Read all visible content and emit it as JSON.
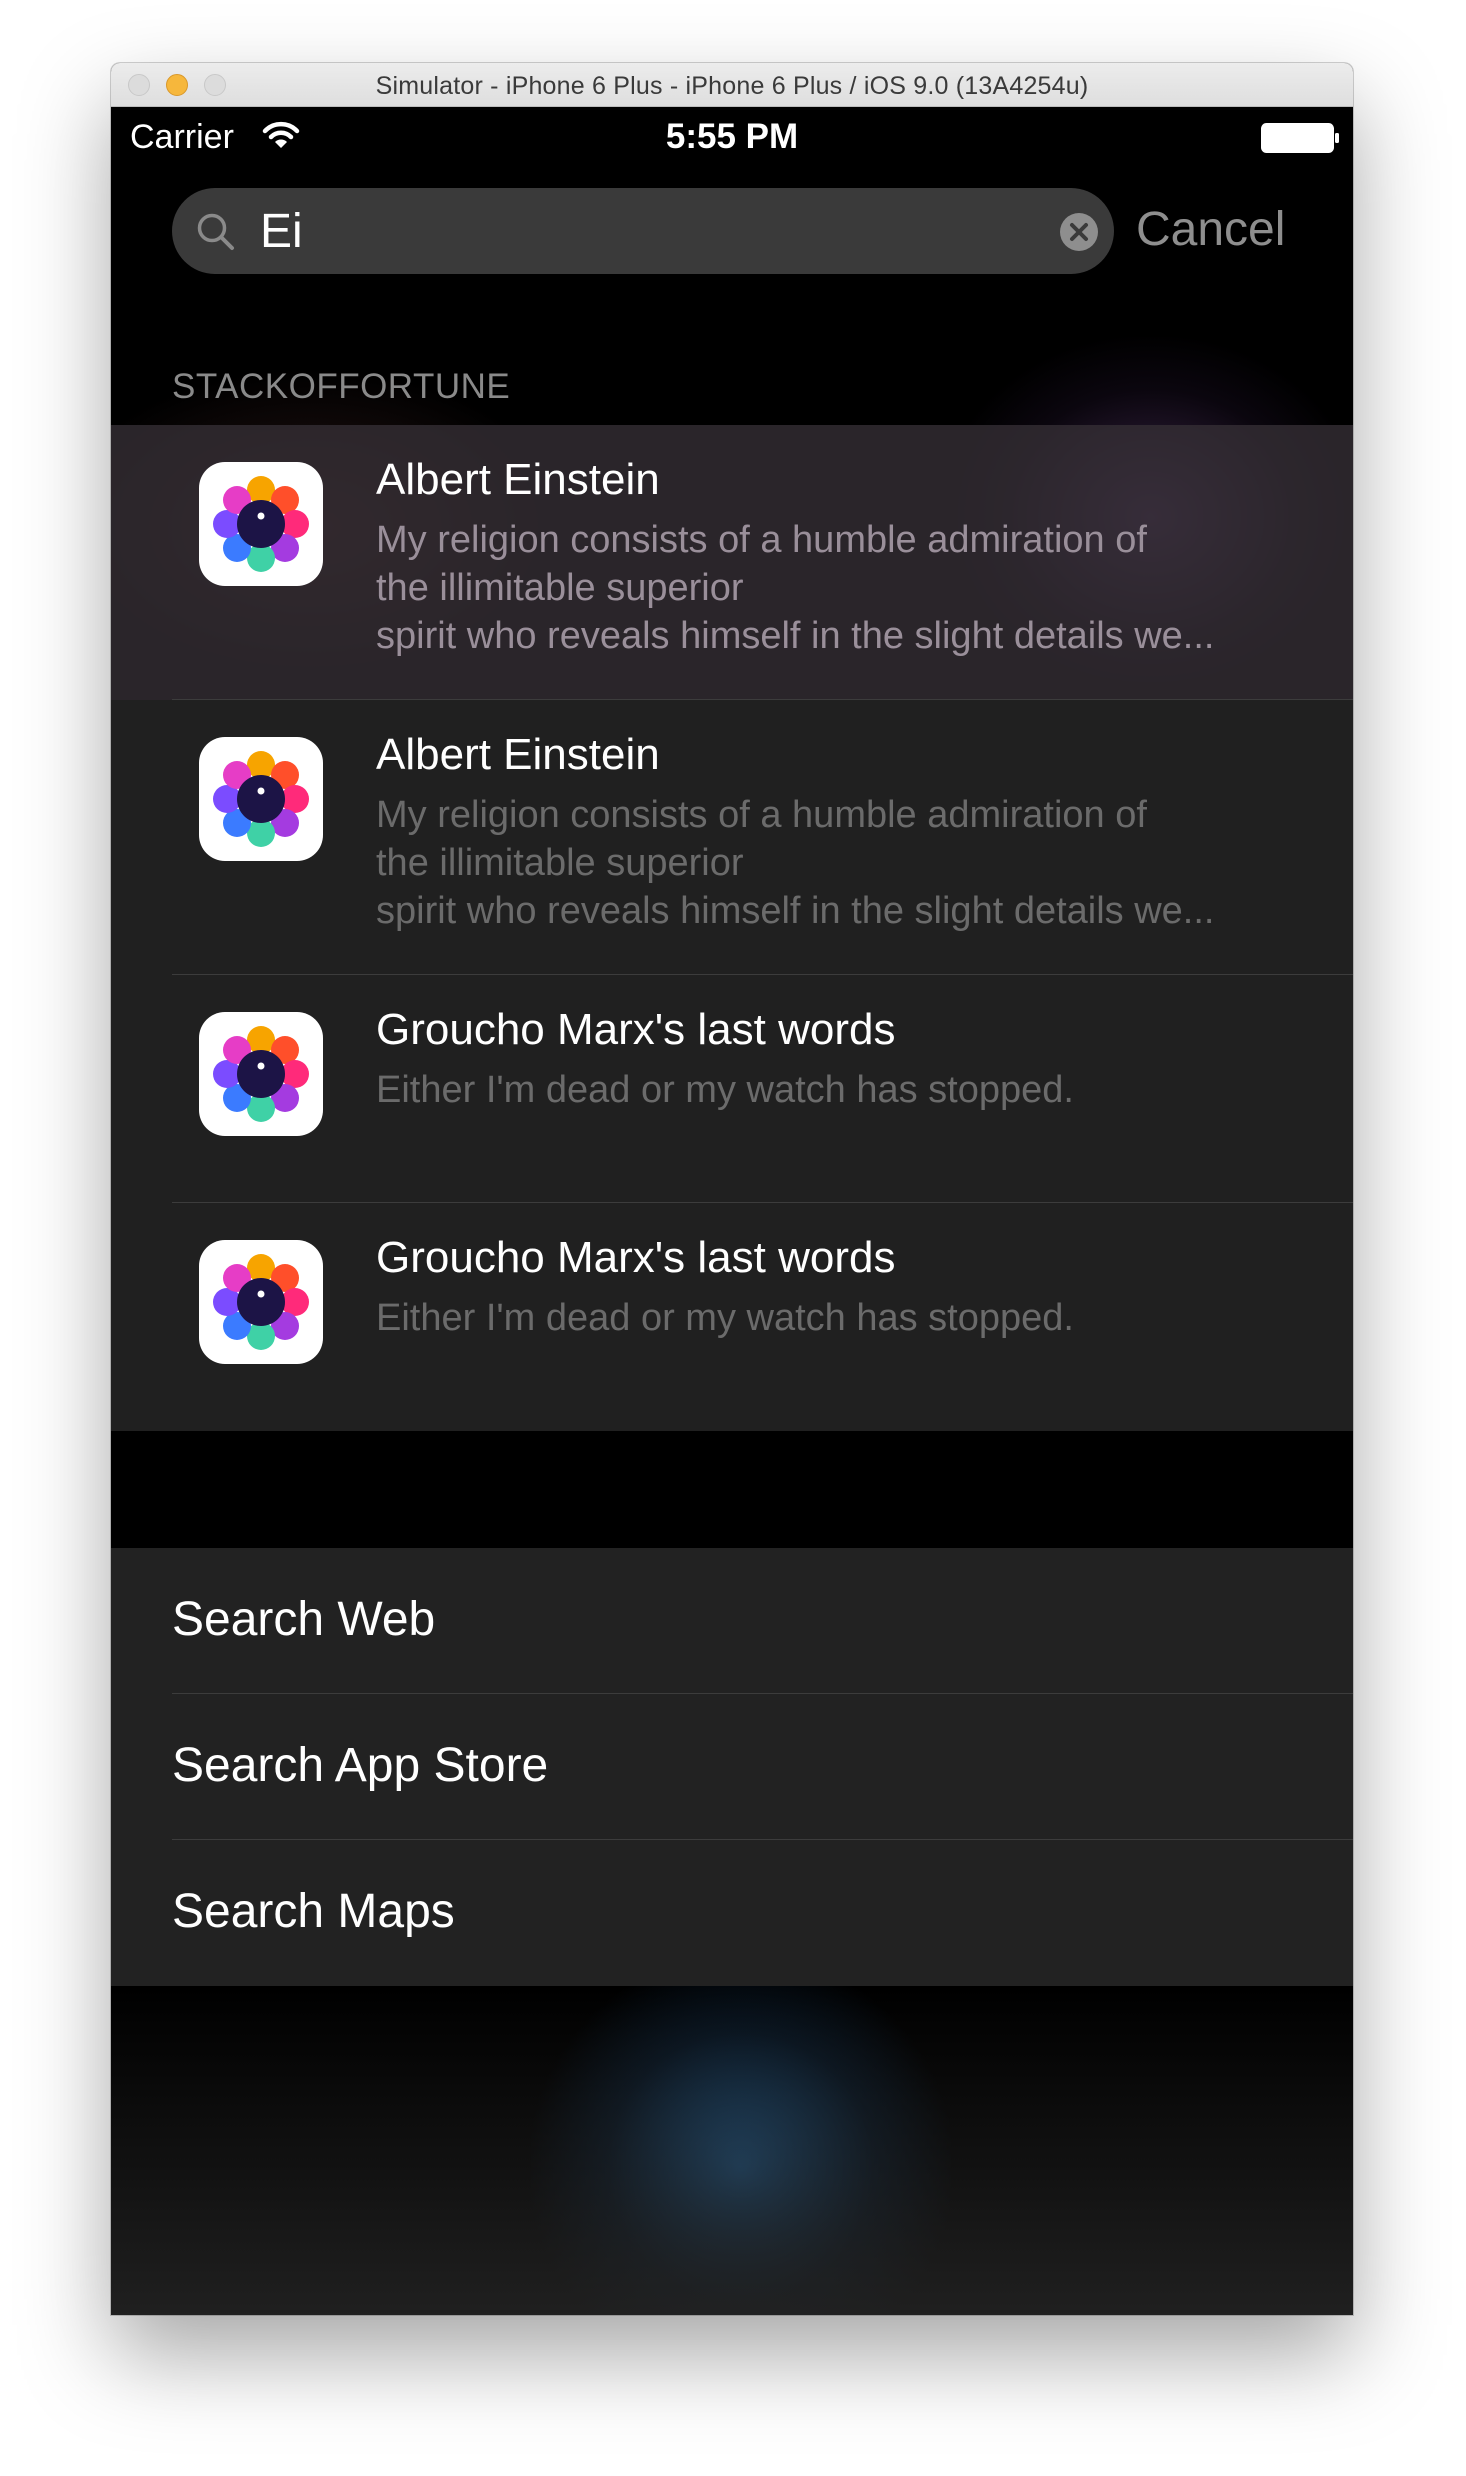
{
  "window": {
    "title": "Simulator - iPhone 6 Plus - iPhone 6 Plus / iOS 9.0 (13A4254u)"
  },
  "status_bar": {
    "carrier": "Carrier",
    "time": "5:55 PM",
    "wifi_icon": "wifi-icon",
    "battery_icon": "battery-icon"
  },
  "search": {
    "query": "Ei",
    "search_icon": "search-icon",
    "clear_icon": "clear-icon",
    "cancel_label": "Cancel"
  },
  "section_header": "STACKOFFORTUNE",
  "results": [
    {
      "title": "Albert Einstein",
      "lines": [
        "My religion consists of a humble admiration of",
        "the illimitable superior",
        "spirit who reveals himself in the slight details we..."
      ]
    },
    {
      "title": "Albert Einstein",
      "lines": [
        "My religion consists of a humble admiration of",
        "the illimitable superior",
        "spirit who reveals himself in the slight details we..."
      ]
    },
    {
      "title": "Groucho Marx's last words",
      "lines": [
        "Either I'm dead or my watch has stopped."
      ]
    },
    {
      "title": "Groucho Marx's last words",
      "lines": [
        "Either I'm dead or my watch has stopped."
      ]
    }
  ],
  "actions": [
    {
      "label": "Search Web"
    },
    {
      "label": "Search App Store"
    },
    {
      "label": "Search Maps"
    }
  ],
  "colors": {
    "background": "#000000",
    "cell": "#242424",
    "secondary_text": "#6b6b6b",
    "cancel_text": "#8e8e8e",
    "traffic_light_minimize": "#f6b73c"
  }
}
